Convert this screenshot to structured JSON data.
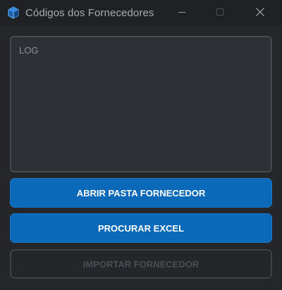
{
  "window": {
    "title": "Códigos dos Fornecedores",
    "app_icon": "cube-icon",
    "controls": {
      "minimize": "minimize-icon",
      "maximize": "maximize-icon",
      "close": "close-icon"
    }
  },
  "log": {
    "label": "LOG"
  },
  "buttons": {
    "abrir_pasta": "ABRIR PASTA FORNECEDOR",
    "procurar_excel": "PROCURAR EXCEL",
    "importar": "IMPORTAR FORNECEDOR"
  },
  "colors": {
    "accent": "#0a69b8",
    "background": "#242629",
    "log_background": "#2d3135",
    "disabled_text": "#4a4e53"
  }
}
